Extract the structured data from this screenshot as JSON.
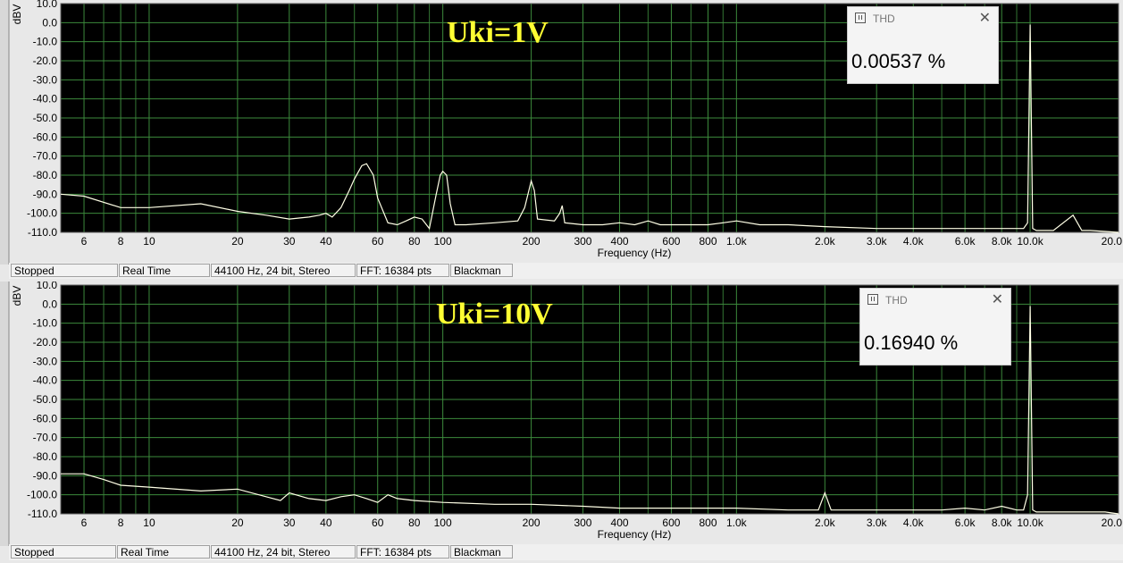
{
  "colors": {
    "plot_bg": "#000000",
    "grid": "#3c8a3c",
    "trace": "#ffffe6",
    "annotation": "#ffff33",
    "axis_text": "#000000"
  },
  "panels": [
    {
      "annotation": "Uki=1V",
      "thd_window": {
        "title": "THD",
        "value": "0.00537 %",
        "icon": "window-icon",
        "close_icon": "close-icon"
      },
      "status": [
        "Stopped",
        "Real Time",
        "44100 Hz, 24 bit, Stereo",
        "FFT: 16384 pts",
        "Blackman"
      ],
      "chart_data": {
        "type": "line",
        "xlabel": "Frequency (Hz)",
        "ylabel": "dBV",
        "x_scale": "log",
        "xlim": [
          5,
          20000
        ],
        "ylim": [
          -110,
          10
        ],
        "grid": true,
        "yticks": [
          "10.0",
          "0.0",
          "-10.0",
          "-20.0",
          "-30.0",
          "-40.0",
          "-50.0",
          "-60.0",
          "-70.0",
          "-80.0",
          "-90.0",
          "-100.0",
          "-110.0"
        ],
        "xticks": [
          {
            "v": 6,
            "l": "6"
          },
          {
            "v": 8,
            "l": "8"
          },
          {
            "v": 10,
            "l": "10"
          },
          {
            "v": 20,
            "l": "20"
          },
          {
            "v": 30,
            "l": "30"
          },
          {
            "v": 40,
            "l": "40"
          },
          {
            "v": 60,
            "l": "60"
          },
          {
            "v": 80,
            "l": "80"
          },
          {
            "v": 100,
            "l": "100"
          },
          {
            "v": 200,
            "l": "200"
          },
          {
            "v": 300,
            "l": "300"
          },
          {
            "v": 400,
            "l": "400"
          },
          {
            "v": 600,
            "l": "600"
          },
          {
            "v": 800,
            "l": "800"
          },
          {
            "v": 1000,
            "l": "1.0k"
          },
          {
            "v": 2000,
            "l": "2.0k"
          },
          {
            "v": 3000,
            "l": "3.0k"
          },
          {
            "v": 4000,
            "l": "4.0k"
          },
          {
            "v": 6000,
            "l": "6.0k"
          },
          {
            "v": 8000,
            "l": "8.0k"
          },
          {
            "v": 10000,
            "l": "10.0k"
          },
          {
            "v": 20000,
            "l": "20.0"
          }
        ],
        "series": [
          {
            "x": [
              5,
              6,
              8,
              10,
              15,
              20,
              25,
              30,
              35,
              38,
              40,
              42,
              45,
              48,
              50,
              53,
              55,
              58,
              60,
              65,
              70,
              75,
              80,
              85,
              90,
              95,
              98,
              100,
              103,
              106,
              110,
              120,
              150,
              180,
              190,
              200,
              205,
              210,
              240,
              250,
              255,
              260,
              300,
              350,
              400,
              450,
              500,
              550,
              600,
              700,
              800,
              900,
              1000,
              1200,
              1500,
              2000,
              3000,
              4000,
              5000,
              6000,
              8000,
              9500,
              9800,
              10000,
              10200,
              10500,
              12000,
              14000,
              15000,
              16000,
              20000
            ],
            "y": [
              -90,
              -91,
              -97,
              -97,
              -95,
              -99,
              -101,
              -103,
              -102,
              -101,
              -100,
              -102,
              -97,
              -88,
              -82,
              -75,
              -74,
              -80,
              -92,
              -105,
              -106,
              -104,
              -102,
              -103,
              -108,
              -90,
              -80,
              -78,
              -80,
              -95,
              -106,
              -106,
              -105,
              -104,
              -97,
              -83,
              -88,
              -103,
              -104,
              -100,
              -96,
              -105,
              -106,
              -106,
              -105,
              -106,
              -104,
              -106,
              -106,
              -106,
              -106,
              -105,
              -104,
              -106,
              -106,
              -107,
              -108,
              -108,
              -108,
              -108,
              -108,
              -108,
              -105,
              -1,
              -108,
              -109,
              -109,
              -101,
              -109,
              -109,
              -110
            ]
          }
        ]
      }
    },
    {
      "annotation": "Uki=10V",
      "thd_window": {
        "title": "THD",
        "value": "0.16940 %",
        "icon": "window-icon",
        "close_icon": "close-icon"
      },
      "status": [
        "Stopped",
        "Real Time",
        "44100 Hz, 24 bit, Stereo",
        "FFT: 16384 pts",
        "Blackman"
      ],
      "chart_data": {
        "type": "line",
        "xlabel": "Frequency (Hz)",
        "ylabel": "dBV",
        "x_scale": "log",
        "xlim": [
          5,
          20000
        ],
        "ylim": [
          -110,
          10
        ],
        "grid": true,
        "yticks": [
          "10.0",
          "0.0",
          "-10.0",
          "-20.0",
          "-30.0",
          "-40.0",
          "-50.0",
          "-60.0",
          "-70.0",
          "-80.0",
          "-90.0",
          "-100.0",
          "-110.0"
        ],
        "xticks": [
          {
            "v": 6,
            "l": "6"
          },
          {
            "v": 8,
            "l": "8"
          },
          {
            "v": 10,
            "l": "10"
          },
          {
            "v": 20,
            "l": "20"
          },
          {
            "v": 30,
            "l": "30"
          },
          {
            "v": 40,
            "l": "40"
          },
          {
            "v": 60,
            "l": "60"
          },
          {
            "v": 80,
            "l": "80"
          },
          {
            "v": 100,
            "l": "100"
          },
          {
            "v": 200,
            "l": "200"
          },
          {
            "v": 300,
            "l": "300"
          },
          {
            "v": 400,
            "l": "400"
          },
          {
            "v": 600,
            "l": "600"
          },
          {
            "v": 800,
            "l": "800"
          },
          {
            "v": 1000,
            "l": "1.0k"
          },
          {
            "v": 2000,
            "l": "2.0k"
          },
          {
            "v": 3000,
            "l": "3.0k"
          },
          {
            "v": 4000,
            "l": "4.0k"
          },
          {
            "v": 6000,
            "l": "6.0k"
          },
          {
            "v": 8000,
            "l": "8.0k"
          },
          {
            "v": 10000,
            "l": "10.0k"
          },
          {
            "v": 20000,
            "l": "20.0"
          }
        ],
        "series": [
          {
            "x": [
              5,
              6,
              7,
              8,
              10,
              15,
              20,
              25,
              28,
              30,
              35,
              40,
              45,
              50,
              55,
              60,
              65,
              70,
              80,
              100,
              150,
              200,
              300,
              400,
              600,
              1000,
              1500,
              1900,
              2000,
              2100,
              3000,
              4000,
              5000,
              6000,
              7000,
              8000,
              9000,
              9500,
              9800,
              10000,
              10200,
              10500,
              12000,
              15000,
              18000,
              20000
            ],
            "y": [
              -89,
              -89,
              -92,
              -95,
              -96,
              -98,
              -97,
              -101,
              -103,
              -99,
              -102,
              -103,
              -101,
              -100,
              -102,
              -104,
              -100,
              -102,
              -103,
              -104,
              -105,
              -105,
              -106,
              -107,
              -107,
              -107,
              -108,
              -108,
              -99,
              -108,
              -108,
              -108,
              -108,
              -107,
              -108,
              -106,
              -108,
              -108,
              -100,
              -1,
              -108,
              -109,
              -109,
              -109,
              -109,
              -110
            ]
          }
        ]
      }
    }
  ]
}
